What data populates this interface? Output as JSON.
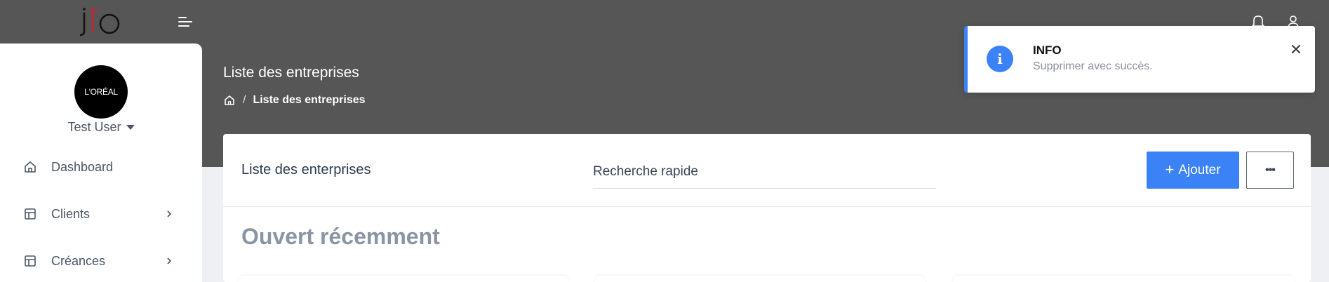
{
  "header": {
    "logo_icon": "j-l-o-logo",
    "menu_icon": "hamburger-icon",
    "notifications_icon": "bell-icon",
    "account_icon": "user-icon"
  },
  "sidebar": {
    "avatar_text": "L'ORÉAL",
    "user_name": "Test User",
    "items": [
      {
        "label": "Dashboard",
        "icon": "home-icon",
        "has_submenu": false
      },
      {
        "label": "Clients",
        "icon": "table-icon",
        "has_submenu": true
      },
      {
        "label": "Créances",
        "icon": "table-icon",
        "has_submenu": true
      }
    ]
  },
  "page": {
    "title": "Liste des entreprises",
    "breadcrumb": [
      "Liste des entreprises"
    ]
  },
  "card": {
    "title": "Liste des enterprises",
    "search_placeholder": "Recherche rapide",
    "add_label": "Ajouter",
    "add_plus": "+",
    "more_label": "•••",
    "section_title": "Ouvert récemment"
  },
  "toast": {
    "title": "INFO",
    "message": "Supprimer avec succès.",
    "icon_glyph": "i"
  },
  "colors": {
    "header_bg": "#565656",
    "accent": "#3b82f6",
    "page_bg": "#eef0f4",
    "logo_red": "#d0202c"
  }
}
